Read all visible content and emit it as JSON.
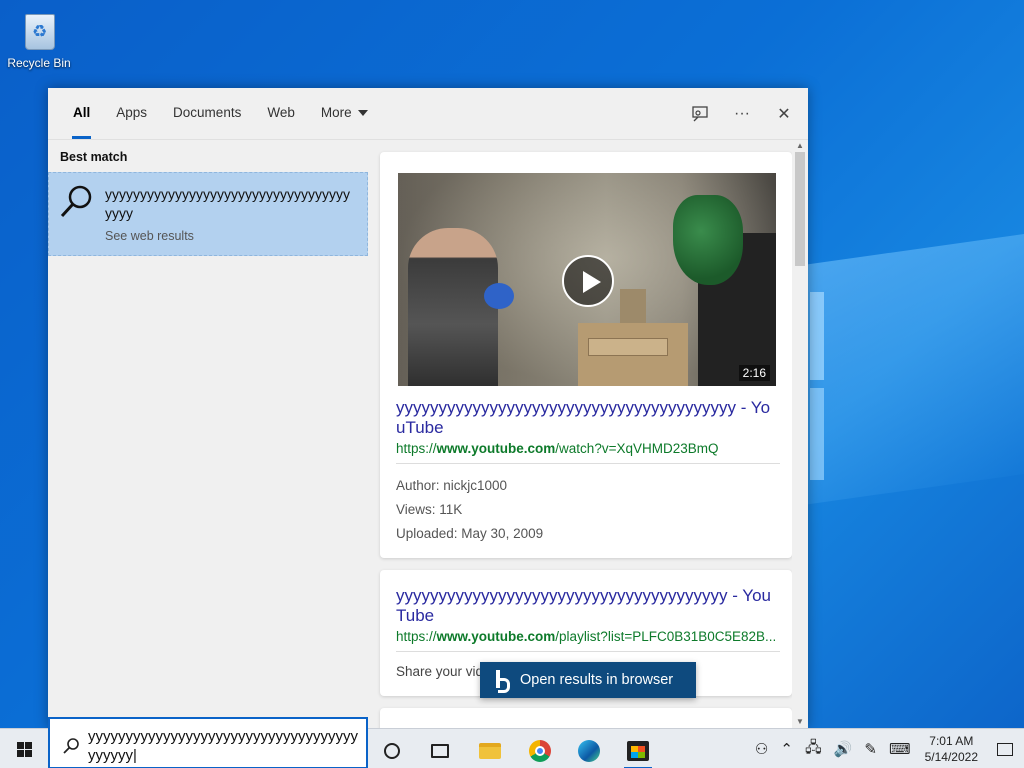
{
  "desktop": {
    "recycle_bin_label": "Recycle Bin"
  },
  "search_panel": {
    "tabs": [
      {
        "label": "All",
        "active": true
      },
      {
        "label": "Apps",
        "active": false
      },
      {
        "label": "Documents",
        "active": false
      },
      {
        "label": "Web",
        "active": false
      },
      {
        "label": "More",
        "active": false
      }
    ],
    "actions": {
      "feedback_icon": "feedback-icon",
      "options_icon": "more-options-icon",
      "close_icon": "close-icon",
      "ellipsis": "···",
      "close_glyph": "✕"
    },
    "best_match": {
      "section_label": "Best match",
      "title": "yyyyyyyyyyyyyyyyyyyyyyyyyyyyyyyyyyyyyyy",
      "subtitle": "See web results"
    },
    "results": [
      {
        "title": "yyyyyyyyyyyyyyyyyyyyyyyyyyyyyyyyyyyyyyyy - YouTube",
        "url_prefix": "https://",
        "url_domain": "www.youtube.com",
        "url_path": "/watch?v=XqVHMD23BmQ",
        "duration": "2:16",
        "author": "Author: nickjc1000",
        "views": "Views: 11K",
        "uploaded": "Uploaded: May 30, 2009"
      },
      {
        "title": "yyyyyyyyyyyyyyyyyyyyyyyyyyyyyyyyyyyyyyy - YouTube",
        "url_prefix": "https://",
        "url_domain": "www.youtube.com",
        "url_path": "/playlist?list=PLFC0B31B0C5E82B...",
        "description": "Share your vid                                        orld"
      }
    ],
    "open_in_browser": "Open results in browser"
  },
  "taskbar": {
    "search_text": "yyyyyyyyyyyyyyyyyyyyyyyyyyyyyyyyyyyyyyyyyy|",
    "clock_time": "7:01 AM",
    "clock_date": "5/14/2022"
  },
  "colors": {
    "accent": "#0a63c8",
    "best_match_bg": "#b3d1ef",
    "link_title": "#2a2aa0",
    "link_url": "#0d7a2a",
    "open_browser_bg": "#0e4a7e"
  }
}
